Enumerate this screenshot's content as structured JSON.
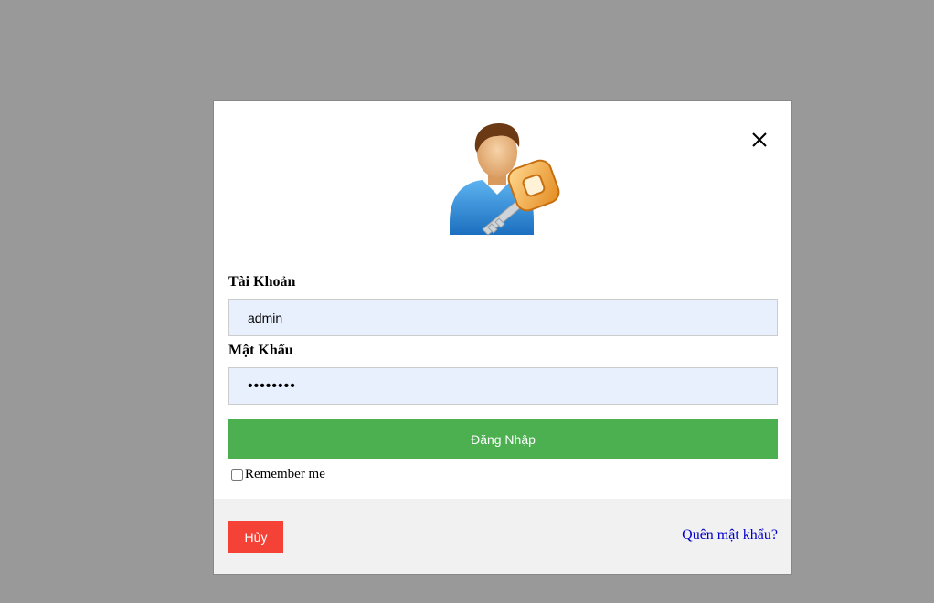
{
  "login_modal": {
    "close_icon": "close-icon",
    "avatar_icon": "user-key-icon",
    "username_label": "Tài Khoản",
    "username_value": "admin",
    "password_label": "Mật Khẩu",
    "password_value": "12345678",
    "login_button": "Đăng Nhập",
    "remember_label": "Remember me",
    "remember_checked": false,
    "cancel_button": "Hủy",
    "forgot_link": "Quên mật khẩu?",
    "colors": {
      "login_button": "#4caf50",
      "cancel_button": "#f44336",
      "link": "#0000cc",
      "overlay": "#999999",
      "input_bg": "#e8f0fe"
    }
  }
}
